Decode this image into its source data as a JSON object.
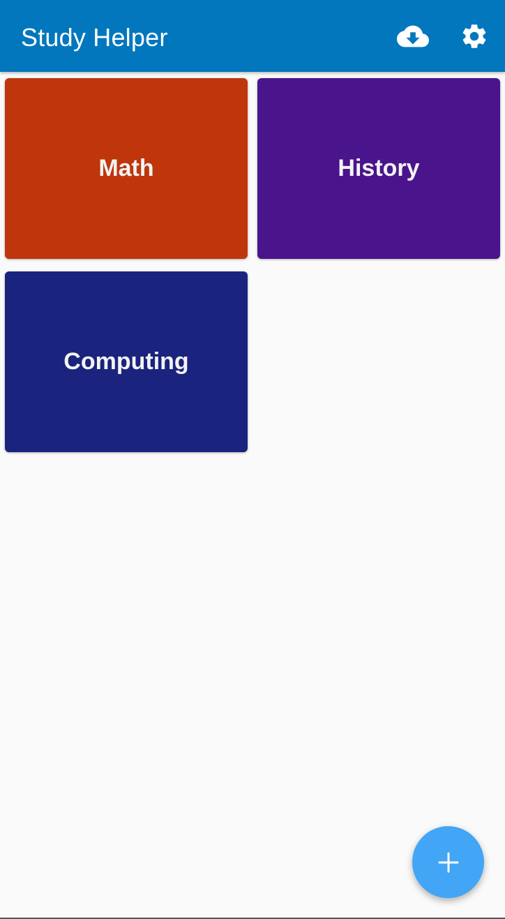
{
  "app_bar": {
    "title": "Study Helper",
    "background": "#0277bd",
    "actions": [
      {
        "icon": "cloud-download-icon"
      },
      {
        "icon": "gear-icon"
      }
    ]
  },
  "subjects": [
    {
      "label": "Math",
      "color": "#bf360c"
    },
    {
      "label": "History",
      "color": "#4a148c"
    },
    {
      "label": "Computing",
      "color": "#1a237e"
    }
  ],
  "fab": {
    "icon": "plus-icon",
    "color": "#42a5f5"
  },
  "background": "#fafafa"
}
